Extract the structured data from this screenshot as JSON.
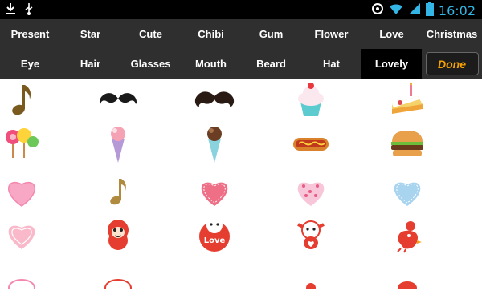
{
  "status_bar": {
    "time": "16:02",
    "left_icons": [
      "download-icon",
      "usb-icon"
    ],
    "right_icons": [
      "sync-icon",
      "wifi-icon",
      "signal-icon",
      "battery-icon"
    ]
  },
  "menu": {
    "row1": [
      "Present",
      "Star",
      "Cute",
      "Chibi",
      "Gum",
      "Flower",
      "Love",
      "Christmas"
    ],
    "row2": [
      "Eye",
      "Hair",
      "Glasses",
      "Mouth",
      "Beard",
      "Hat",
      "Lovely"
    ],
    "selected": "Lovely",
    "done_label": "Done"
  },
  "stickers": [
    [
      "music-note",
      "mustache-thin",
      "mustache-thick",
      "cupcake",
      "cake-slice"
    ],
    [
      "lollipops",
      "ice-cream-purple",
      "ice-cream-chocolate",
      "hot-dog",
      "burger"
    ],
    [
      "heart-pink",
      "music-note-gold",
      "heart-coral",
      "heart-dotted",
      "heart-blue"
    ],
    [
      "heart-lace",
      "cartoon-pig",
      "love-face",
      "cartoon-hug",
      "cartoon-bird"
    ]
  ],
  "colors": {
    "status_bar_bg": "#000000",
    "status_accent": "#33b5e5",
    "menu_bg": "#2f2f2f",
    "menu_selected_bg": "#000000",
    "done_text": "#f5a100"
  }
}
